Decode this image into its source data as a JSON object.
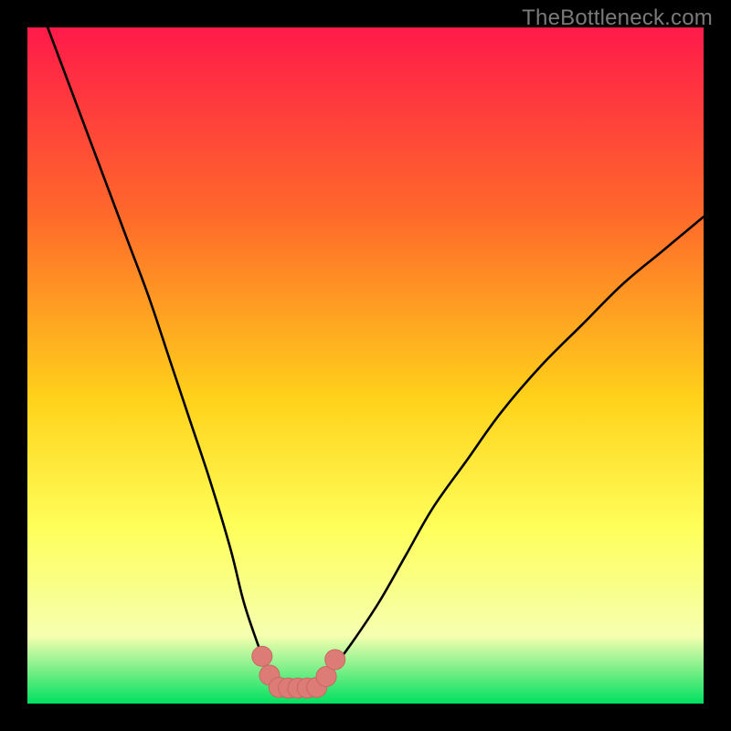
{
  "watermark": "TheBottleneck.com",
  "colors": {
    "bg_black": "#000000",
    "grad_top": "#ff1a4a",
    "grad_mid1": "#ff6a2a",
    "grad_mid2": "#ffd21a",
    "grad_mid3": "#ffff5a",
    "grad_mid4": "#f5ffb0",
    "grad_bottom": "#00e060",
    "curve": "#000000",
    "marker_fill": "#dd7b77",
    "marker_stroke": "#c86862",
    "marker_radius": 11
  },
  "chart_data": {
    "type": "line",
    "title": "",
    "xlabel": "",
    "ylabel": "",
    "xlim": [
      0,
      100
    ],
    "ylim": [
      0,
      100
    ],
    "grid": false,
    "legend": "none",
    "series": [
      {
        "name": "left-branch",
        "x": [
          3,
          6,
          9,
          12,
          15,
          18,
          21,
          24,
          27,
          30,
          32,
          34,
          35.5,
          37
        ],
        "y": [
          100,
          92,
          84,
          76,
          68,
          60,
          51,
          42,
          33,
          23,
          15,
          9,
          5,
          2.5
        ]
      },
      {
        "name": "right-branch",
        "x": [
          43,
          45,
          48,
          52,
          56,
          60,
          65,
          70,
          76,
          82,
          88,
          94,
          100
        ],
        "y": [
          2.5,
          5,
          9,
          15,
          22,
          29,
          36,
          43,
          50,
          56,
          62,
          67,
          72
        ]
      },
      {
        "name": "flat-bottom",
        "x": [
          37,
          38.5,
          40,
          41.5,
          43
        ],
        "y": [
          2.5,
          2.3,
          2.3,
          2.3,
          2.5
        ]
      }
    ],
    "markers": [
      {
        "series": "left-branch",
        "x": 34.7,
        "y": 7.0
      },
      {
        "series": "left-branch",
        "x": 35.8,
        "y": 4.2
      },
      {
        "series": "flat-bottom",
        "x": 37.2,
        "y": 2.4
      },
      {
        "series": "flat-bottom",
        "x": 38.6,
        "y": 2.3
      },
      {
        "series": "flat-bottom",
        "x": 40.0,
        "y": 2.3
      },
      {
        "series": "flat-bottom",
        "x": 41.4,
        "y": 2.3
      },
      {
        "series": "flat-bottom",
        "x": 42.8,
        "y": 2.4
      },
      {
        "series": "right-branch",
        "x": 44.2,
        "y": 4.0
      },
      {
        "series": "right-branch",
        "x": 45.5,
        "y": 6.5
      }
    ]
  }
}
